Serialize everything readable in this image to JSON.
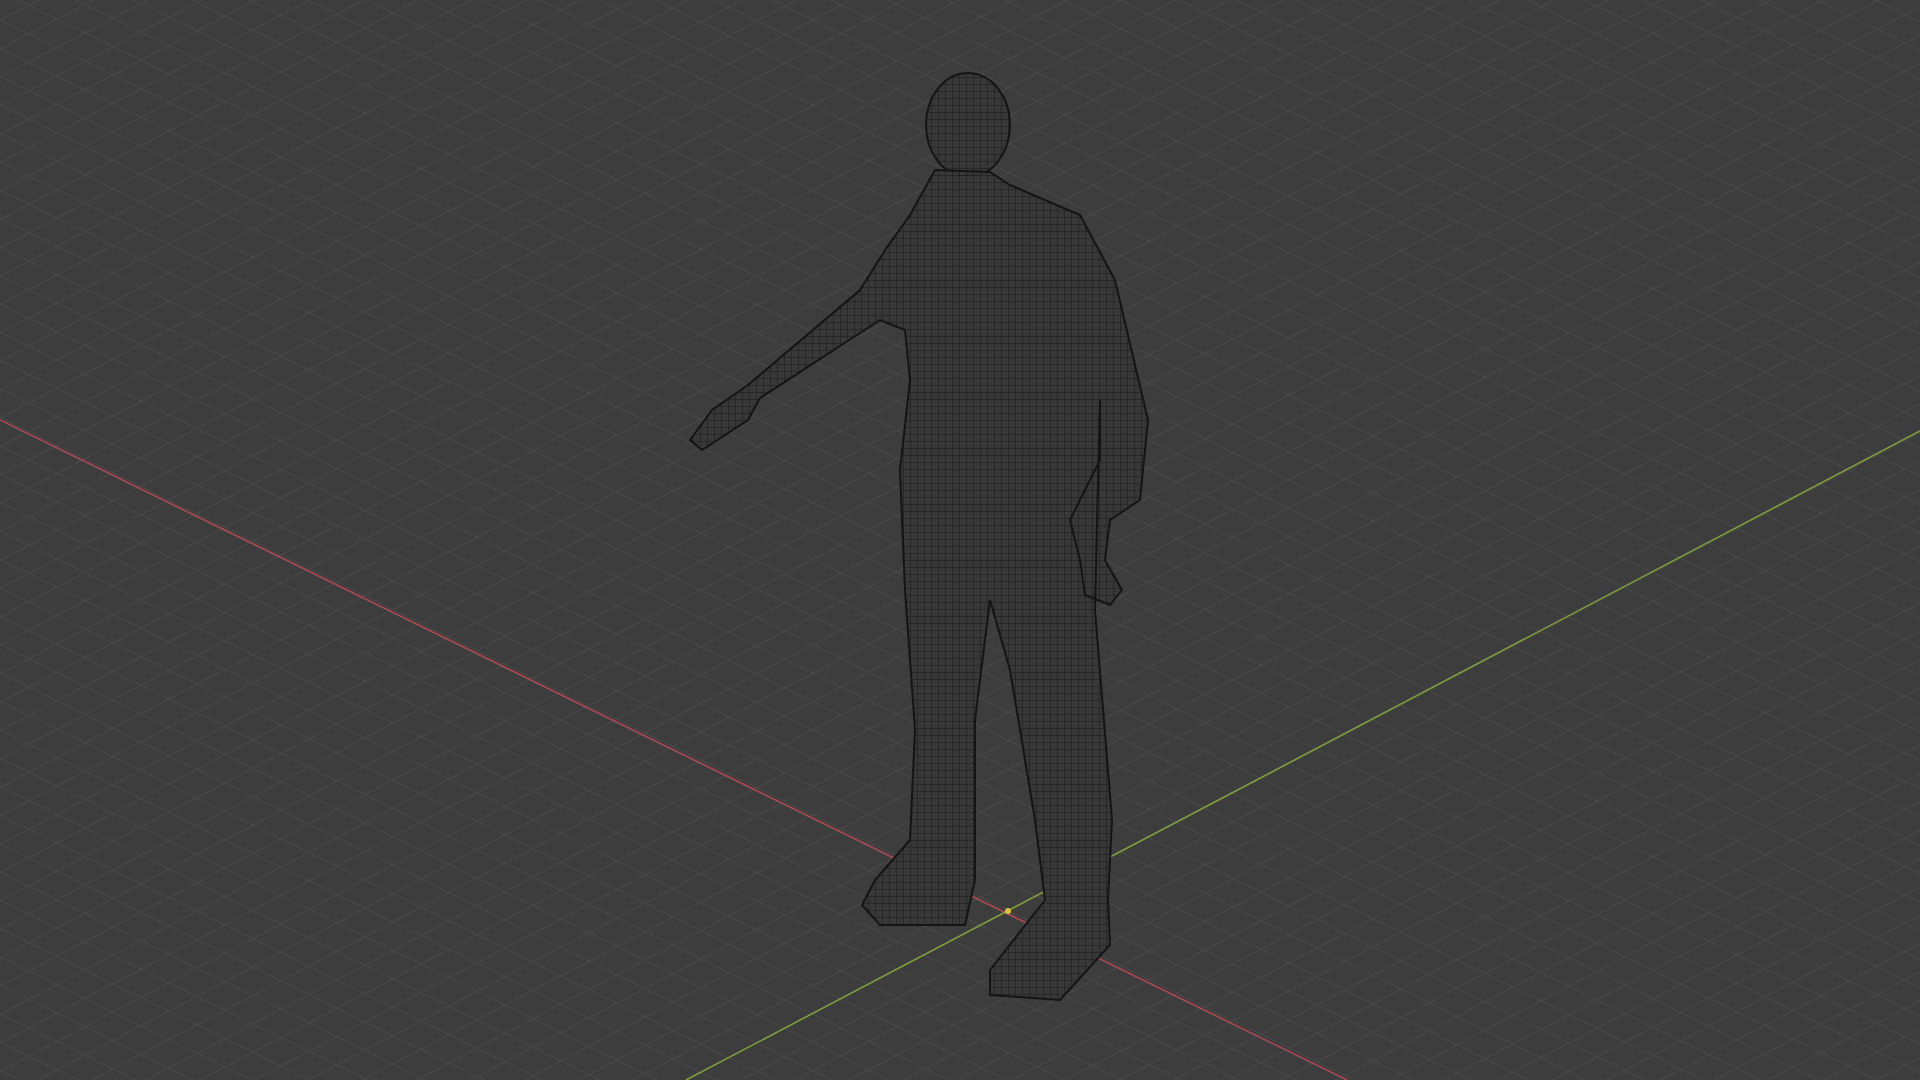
{
  "axes": [
    {
      "color": "#b34a52"
    },
    {
      "color": "#7fa33a"
    }
  ]
}
